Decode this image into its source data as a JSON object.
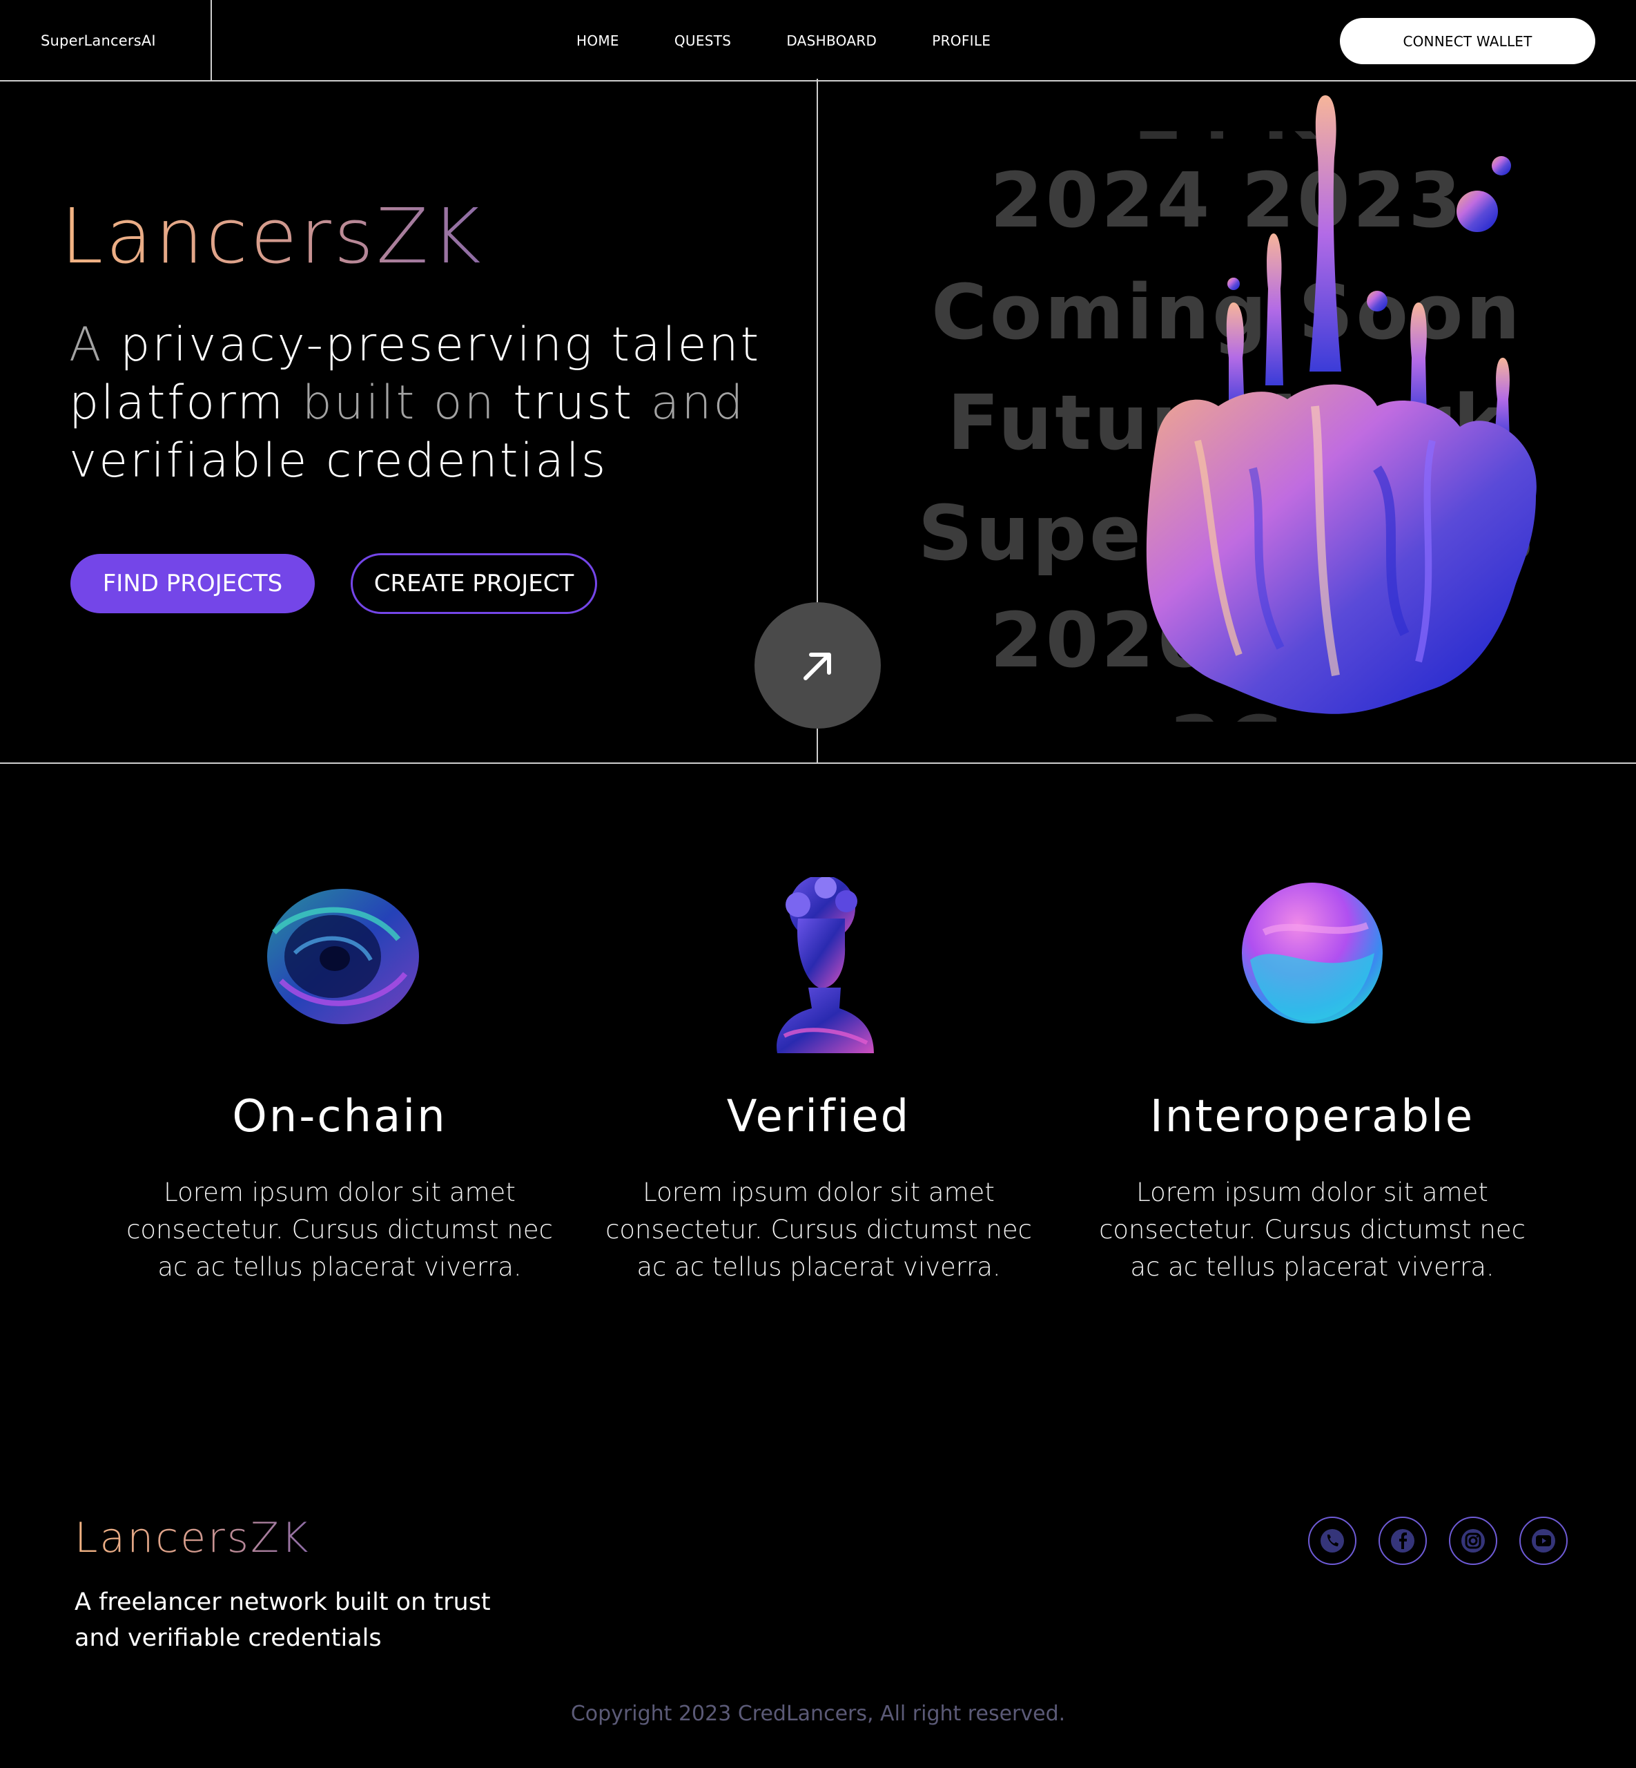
{
  "nav": {
    "brand": "SuperLancersAI",
    "items": [
      "HOME",
      "QUESTS",
      "DASHBOARD",
      "PROFILE"
    ],
    "wallet_label": "CONNECT WALLET"
  },
  "hero": {
    "logo": "LancersZK",
    "tagline": {
      "w1": "A",
      "w2": "privacy-preserving talent",
      "w3": "platform",
      "w4": "built on",
      "w5": "trust",
      "w6": "and",
      "w7": "verifiable credentials"
    },
    "find_label": "FIND PROJECTS",
    "create_label": "CREATE PROJECT",
    "ticker": [
      "2024 2023",
      "Coming Soon",
      "Future Work",
      "SuperLancers",
      "2026 2027"
    ]
  },
  "features": [
    {
      "title": "On-chain",
      "body": "Lorem ipsum dolor sit amet consectetur. Cursus dictumst nec ac ac tellus placerat viverra.",
      "icon": "torus-icon"
    },
    {
      "title": "Verified",
      "body": "Lorem ipsum dolor sit amet consectetur. Cursus dictumst nec ac ac tellus placerat viverra.",
      "icon": "bust-icon"
    },
    {
      "title": "Interoperable",
      "body": "Lorem ipsum dolor sit amet consectetur. Cursus dictumst nec ac ac tellus placerat viverra.",
      "icon": "sphere-icon"
    }
  ],
  "footer": {
    "logo": "LancersZK",
    "tagline": "A freelancer network built on trust and verifiable credentials",
    "socials": [
      "phone-icon",
      "facebook-icon",
      "instagram-icon",
      "youtube-icon"
    ],
    "copyright": "Copyright 2023 CredLancers, All right reserved."
  },
  "colors": {
    "accent": "#7446e8",
    "logo_gradient_start": "#f3b483",
    "logo_gradient_end": "#8d6ba6",
    "social_border": "#6e5bd6",
    "copyright": "#5b5a77"
  }
}
